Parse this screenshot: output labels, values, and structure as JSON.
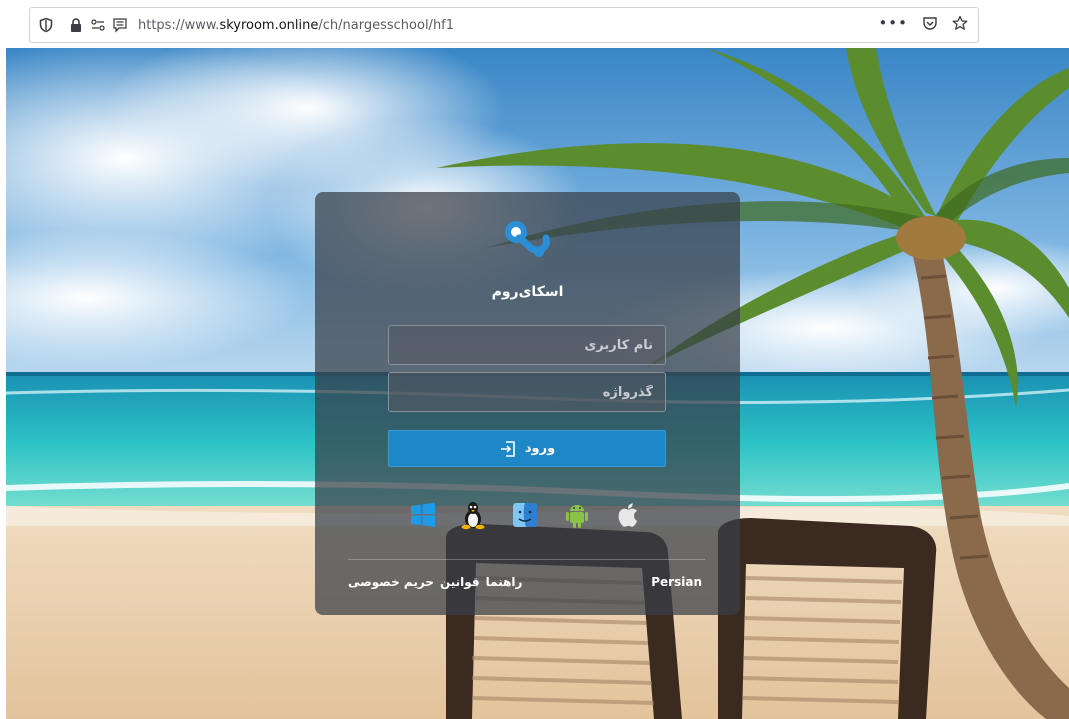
{
  "browser": {
    "url_prefix": "https://www.",
    "url_host": "skyroom.online",
    "url_path": "/ch/nargesschool/hf1",
    "icons": [
      "shield-icon",
      "lock-icon",
      "permissions-icon",
      "reader-mode-icon",
      "more-actions-icon",
      "pocket-icon",
      "bookmark-star-icon"
    ],
    "more_label": "•••"
  },
  "login": {
    "brand": "اسکای‌روم",
    "username_placeholder": "نام کاربری",
    "password_placeholder": "گذرواژه",
    "submit_label": "ورود",
    "submit_icon": "sign-in-icon",
    "accent_color": "#1e88c7",
    "platforms": [
      {
        "name": "Windows",
        "icon": "windows-icon"
      },
      {
        "name": "Linux",
        "icon": "linux-icon"
      },
      {
        "name": "macOS",
        "icon": "mac-finder-icon"
      },
      {
        "name": "Android",
        "icon": "android-icon"
      },
      {
        "name": "iOS",
        "icon": "apple-icon"
      }
    ],
    "footer": {
      "guide": "راهنما",
      "rules": "قوانین",
      "privacy": "حریم خصوصی",
      "language": "Persian"
    }
  }
}
